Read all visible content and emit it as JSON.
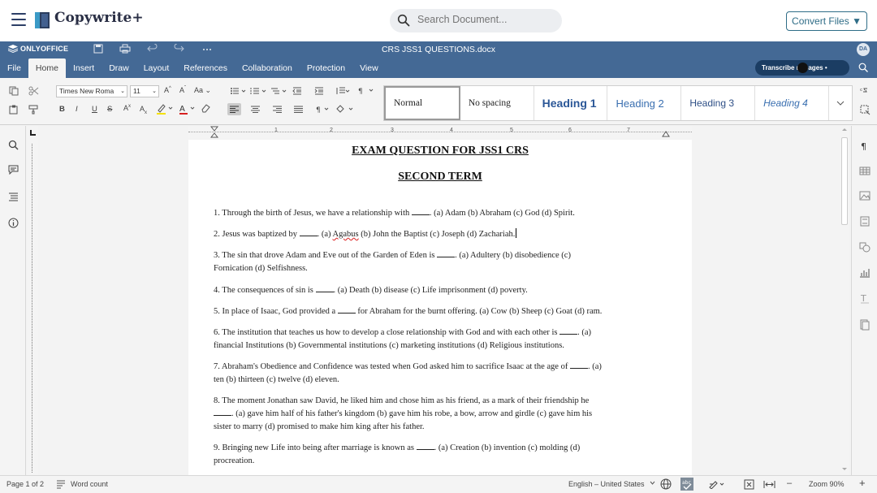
{
  "app": {
    "title": "Copywrite+",
    "search_placeholder": "Search Document...",
    "convert_label": "Convert Files ▼"
  },
  "editor": {
    "brand": "ONLYOFFICE",
    "doc_title": "CRS JSS1 QUESTIONS.docx",
    "avatar": "DA",
    "tabs": [
      "File",
      "Home",
      "Insert",
      "Draw",
      "Layout",
      "References",
      "Collaboration",
      "Protection",
      "View"
    ],
    "active_tab": "Home",
    "transcribe_label": "Transcribe      re pages •"
  },
  "toolbar": {
    "font_name": "Times New Roma",
    "font_size": "11",
    "styles": [
      "Normal",
      "No spacing",
      "Heading 1",
      "Heading 2",
      "Heading 3",
      "Heading 4"
    ]
  },
  "document": {
    "title": "EXAM QUESTION FOR JSS1 CRS",
    "subtitle": "SECOND TERM",
    "questions": [
      {
        "pre": "1. Through the birth of Jesus, we have a relationship with",
        "post": ". (a) Adam (b) Abraham (c) God (d) Spirit."
      },
      {
        "pre": "2. Jesus was baptized by",
        "post_a": ". (a) ",
        "err": "Agabus",
        "post_b": " (b) John the Baptist (c) Joseph (d) Zachariah."
      },
      {
        "pre": "3. The sin that drove Adam and Eve out of the Garden of Eden is",
        "post": ". (a) Adultery (b) disobedience (c)",
        "line2": "Fornication (d) Selfishness."
      },
      {
        "pre": "4. The consequences of sin is",
        "post": ". (a) Death (b) disease (c) Life imprisonment (d) poverty."
      },
      {
        "pre": "5. In place of Isaac, God provided a",
        "post": "for Abraham for the burnt offering. (a) Cow (b) Sheep (c) Goat (d) ram."
      },
      {
        "pre": "6. The institution that teaches us how to develop a close relationship with God and with each other is",
        "post": ". (a)",
        "line2": "financial Institutions (b) Governmental institutions (c) marketing institutions (d) Religious institutions."
      },
      {
        "pre": "7. Abraham's Obedience and Confidence was tested when God asked him to sacrifice Isaac at the age of",
        "post": ". (a)",
        "line2": "ten (b) thirteen (c) twelve (d) eleven."
      },
      {
        "pre": "8. The moment Jonathan saw David, he liked him and chose him as his friend, as a mark of their friendship he",
        "post": ". (a) gave him half of his father's kingdom (b) gave him his robe, a bow, arrow and girdle (c) gave him his",
        "line3": "sister to marry (d) promised to make him king after his father."
      },
      {
        "pre": "9. Bringing new Life into being after marriage is known as",
        "post": ". (a) Creation (b) invention (c) molding (d)",
        "line2": "procreation."
      }
    ]
  },
  "status": {
    "page": "Page 1 of 2",
    "word_count": "Word count",
    "language": "English – United States",
    "zoom": "Zoom 90%",
    "minus": "–",
    "plus": "+"
  },
  "ruler": {
    "numbers": [
      "1",
      "2",
      "3",
      "4",
      "5",
      "6",
      "7"
    ]
  }
}
